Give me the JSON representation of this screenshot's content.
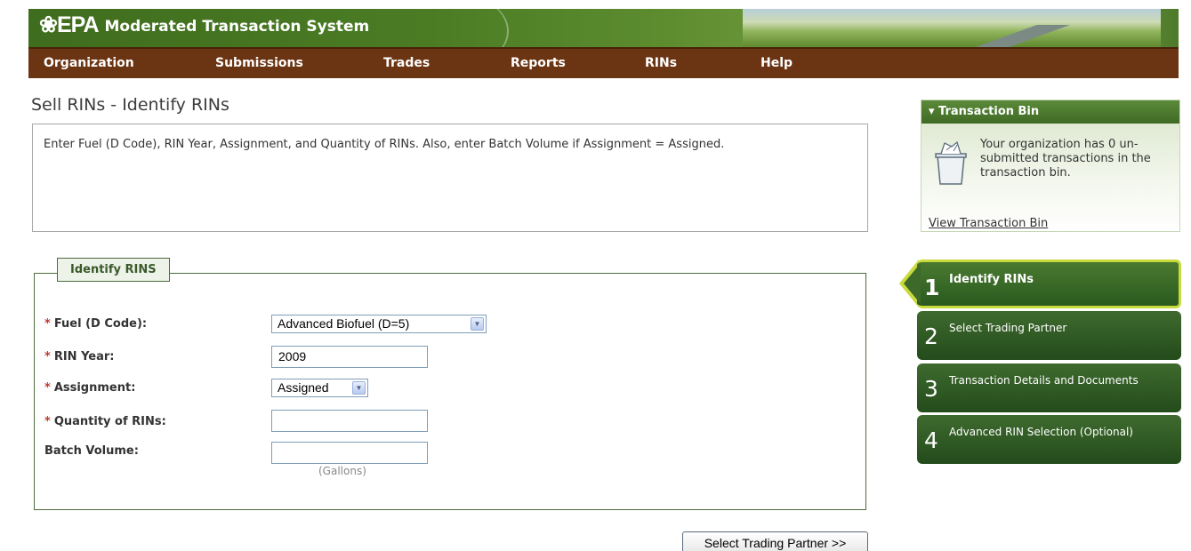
{
  "header": {
    "logo_mark": "❀EPA",
    "system_title": "Moderated Transaction System"
  },
  "nav": {
    "items": [
      {
        "label": "Organization"
      },
      {
        "label": "Submissions"
      },
      {
        "label": "Trades"
      },
      {
        "label": "Reports"
      },
      {
        "label": "RINs"
      },
      {
        "label": "Help"
      }
    ]
  },
  "page": {
    "title": "Sell RINs - Identify RINs",
    "instructions": "Enter Fuel (D Code), RIN Year, Assignment, and Quantity of RINs. Also, enter Batch Volume if Assignment = Assigned."
  },
  "form": {
    "legend": "Identify RINS",
    "required_marker": "*",
    "fuel": {
      "label": "Fuel (D Code):",
      "value": "Advanced Biofuel (D=5)"
    },
    "rin_year": {
      "label": "RIN Year:",
      "value": "2009"
    },
    "assignment": {
      "label": "Assignment:",
      "value": "Assigned"
    },
    "quantity": {
      "label": "Quantity of RINs:",
      "value": ""
    },
    "batch_volume": {
      "label": "Batch Volume:",
      "value": "",
      "hint": "(Gallons)"
    },
    "next_button": "Select Trading Partner >>"
  },
  "transaction_bin": {
    "title": "▾ Transaction Bin",
    "message": "Your organization has 0 un-submitted transactions in the transaction bin.",
    "link": "View Transaction Bin"
  },
  "steps": [
    {
      "number": "1",
      "label": "Identify RINs",
      "active": true
    },
    {
      "number": "2",
      "label": "Select Trading Partner",
      "active": false
    },
    {
      "number": "3",
      "label": "Transaction Details and Documents",
      "active": false
    },
    {
      "number": "4",
      "label": "Advanced RIN Selection (Optional)",
      "active": false
    }
  ],
  "colors": {
    "banner_green": "#4b7c24",
    "nav_brown": "#6b3413",
    "step_green": "#2f5a22",
    "active_highlight": "#c9da3c",
    "required_red": "#c0392b"
  }
}
